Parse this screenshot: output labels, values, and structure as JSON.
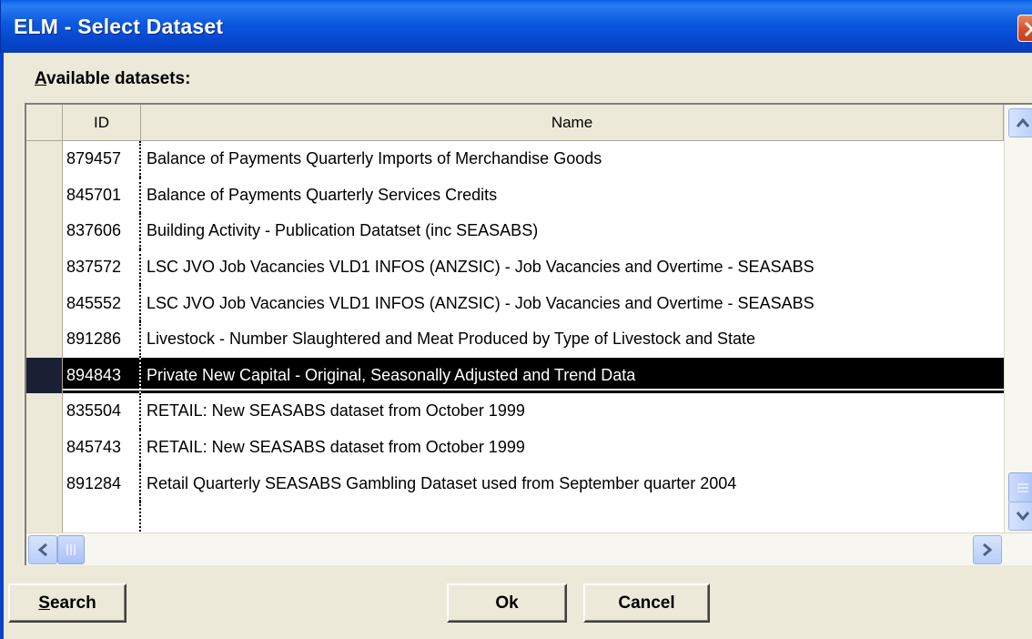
{
  "window": {
    "title": "ELM - Select Dataset"
  },
  "label": {
    "first_letter": "A",
    "rest": "vailable datasets:"
  },
  "grid": {
    "columns": [
      "ID",
      "Name"
    ],
    "rows": [
      {
        "id": "879457",
        "name": "Balance of Payments Quarterly Imports of Merchandise Goods",
        "selected": false
      },
      {
        "id": "845701",
        "name": "Balance of Payments Quarterly Services Credits",
        "selected": false
      },
      {
        "id": "837606",
        "name": "Building Activity - Publication Datatset (inc SEASABS)",
        "selected": false
      },
      {
        "id": "837572",
        "name": "LSC JVO Job Vacancies VLD1 INFOS (ANZSIC) - Job Vacancies and Overtime - SEASABS",
        "selected": false
      },
      {
        "id": "845552",
        "name": "LSC JVO Job Vacancies VLD1 INFOS (ANZSIC) - Job Vacancies and Overtime - SEASABS",
        "selected": false
      },
      {
        "id": "891286",
        "name": "Livestock - Number Slaughtered and Meat Produced by Type of Livestock and State",
        "selected": false
      },
      {
        "id": "894843",
        "name": "Private New Capital - Original, Seasonally Adjusted and Trend Data",
        "selected": true
      },
      {
        "id": "835504",
        "name": "RETAIL: New SEASABS dataset from October 1999",
        "selected": false
      },
      {
        "id": "845743",
        "name": "RETAIL: New SEASABS dataset from October 1999",
        "selected": false
      },
      {
        "id": "891284",
        "name": "Retail Quarterly SEASABS Gambling Dataset used from September quarter 2004",
        "selected": false
      },
      {
        "id": "",
        "name": "",
        "selected": false
      }
    ]
  },
  "buttons": {
    "search_first": "S",
    "search_rest": "earch",
    "ok": "Ok",
    "cancel": "Cancel"
  },
  "icons": {
    "close": "close-icon",
    "scroll_up": "chevron-up-icon",
    "scroll_down": "chevron-down-icon",
    "scroll_left": "chevron-left-icon",
    "scroll_right": "chevron-right-icon"
  },
  "colors": {
    "titlebar": "#0b58e0",
    "selection": "#000000"
  }
}
